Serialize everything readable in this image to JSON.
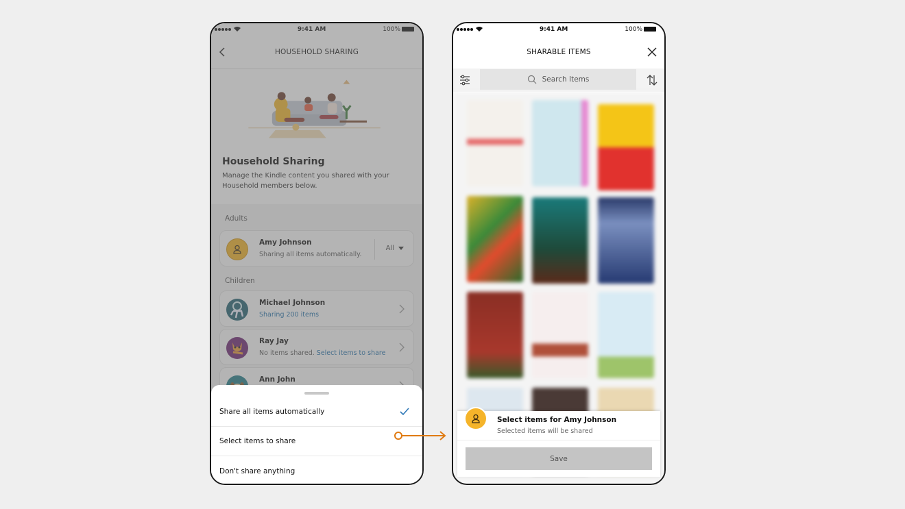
{
  "status_bar": {
    "time": "9:41 AM",
    "battery": "100%"
  },
  "left_screen": {
    "nav_title": "HOUSEHOLD SHARING",
    "hero_title": "Household Sharing",
    "hero_description": "Manage the Kindle content you shared with your Household members below.",
    "sections": {
      "adults_label": "Adults",
      "children_label": "Children"
    },
    "adults": [
      {
        "name": "Amy Johnson",
        "status": "Sharing all items automatically.",
        "dropdown_value": "All"
      }
    ],
    "children": [
      {
        "name": "Michael Johnson",
        "status": "Sharing 200 items",
        "status_link": ""
      },
      {
        "name": "Ray Jay",
        "status": "No items shared.",
        "status_link": "Select items to share"
      },
      {
        "name": "Ann John",
        "status": "",
        "status_link": ""
      }
    ],
    "bottom_sheet": {
      "options": [
        {
          "label": "Share all items automatically",
          "selected": true
        },
        {
          "label": "Select items to share",
          "selected": false
        },
        {
          "label": "Don't share anything",
          "selected": false
        }
      ]
    }
  },
  "right_screen": {
    "nav_title": "SHARABLE ITEMS",
    "search": {
      "placeholder": "Search Items"
    },
    "select_panel": {
      "title": "Select items for Amy Johnson",
      "subtitle": "Selected items will be shared",
      "save_label": "Save"
    }
  },
  "colors": {
    "accent_orange": "#e07b12",
    "link_blue": "#1f6ea8",
    "avatar_yellow": "#f5b42a"
  }
}
